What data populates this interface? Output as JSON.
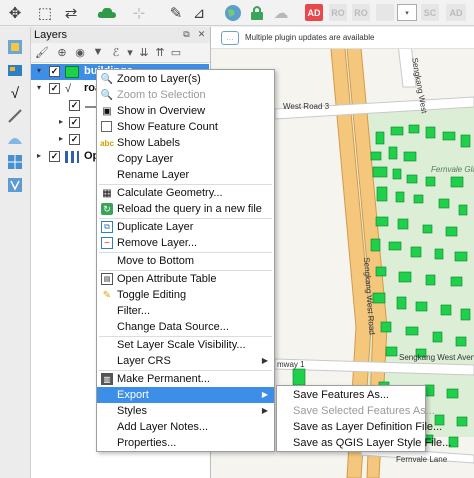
{
  "colors": {
    "selection": "#3d8ee6",
    "building_fill": "#1ed04a",
    "road_major": "#f5c77d",
    "road_minor": "#ffffff",
    "grass": "#d7eed2",
    "disabled_text": "#9a9a9a",
    "badge_red": "#e8474c"
  },
  "toolbar": {
    "icons": [
      "move-feature-icon",
      "pan-icon",
      "cloud-icon",
      "select-icon",
      "digitize-icon",
      "node-icon",
      "globe-icon",
      "lock-icon",
      "cloud-upload-icon"
    ],
    "badges": [
      "AD",
      "RO",
      "RO",
      "SC",
      "AD"
    ],
    "combo_value": ""
  },
  "panel": {
    "title": "Layers",
    "float_glyph": "⧉",
    "close_glyph": "✕"
  },
  "layers": [
    {
      "label": "buildings",
      "checked": true,
      "selected": true
    },
    {
      "label": "roa",
      "checked": true,
      "selected": false
    },
    {
      "label": "",
      "checked": true,
      "selected": false
    },
    {
      "label": "",
      "checked": true,
      "selected": false
    },
    {
      "label": "",
      "checked": true,
      "selected": false
    },
    {
      "label": "Op",
      "checked": true,
      "selected": false
    }
  ],
  "map": {
    "banner_text": "Multiple plugin updates are available",
    "road_labels": {
      "sengkang_road_3": "West Road 3",
      "sengkang_west_road": "Sengkang West Road",
      "sengkang_west_top": "Sengkang West",
      "sengkang_west_avenue": "Sengkang West Avenue",
      "fernvale_glades": "Fernvale Glades",
      "fernvale_lane": "Fernvale Lane",
      "sengkang_west_way": "mway 1"
    }
  },
  "context_menu": {
    "items": [
      {
        "label": "Zoom to Layer(s)",
        "icon": "zoom-layer-icon",
        "disabled": false
      },
      {
        "label": "Zoom to Selection",
        "icon": "zoom-selection-icon",
        "disabled": true
      },
      {
        "label": "Show in Overview",
        "icon": "overview-icon",
        "disabled": false
      },
      {
        "label": "Show Feature Count",
        "icon": "checkbox",
        "disabled": false
      },
      {
        "label": "Show Labels",
        "icon": "labels-icon",
        "disabled": false
      },
      {
        "label": "Copy Layer",
        "icon": "",
        "disabled": false
      },
      {
        "label": "Rename Layer",
        "icon": "",
        "disabled": false
      },
      {
        "label": "Calculate Geometry...",
        "icon": "calculator-icon",
        "disabled": false
      },
      {
        "label": "Reload the query in a new file",
        "icon": "reload-icon",
        "disabled": false
      },
      {
        "label": "Duplicate Layer",
        "icon": "duplicate-icon",
        "disabled": false
      },
      {
        "label": "Remove Layer...",
        "icon": "remove-icon",
        "disabled": false
      },
      {
        "label": "Move to Bottom",
        "icon": "",
        "disabled": false
      },
      {
        "label": "Open Attribute Table",
        "icon": "table-icon",
        "disabled": false
      },
      {
        "label": "Toggle Editing",
        "icon": "pencil-icon",
        "disabled": false
      },
      {
        "label": "Filter...",
        "icon": "",
        "disabled": false
      },
      {
        "label": "Change Data Source...",
        "icon": "",
        "disabled": false
      },
      {
        "label": "Set Layer Scale Visibility...",
        "icon": "",
        "disabled": false
      },
      {
        "label": "Layer CRS",
        "icon": "",
        "disabled": false,
        "submenu": true
      },
      {
        "label": "Make Permanent...",
        "icon": "permanent-icon",
        "disabled": false
      },
      {
        "label": "Export",
        "icon": "",
        "disabled": false,
        "submenu": true,
        "highlighted": true
      },
      {
        "label": "Styles",
        "icon": "",
        "disabled": false,
        "submenu": true
      },
      {
        "label": "Add Layer Notes...",
        "icon": "",
        "disabled": false
      },
      {
        "label": "Properties...",
        "icon": "",
        "disabled": false
      }
    ],
    "submenu_arrow": "▶"
  },
  "export_submenu": {
    "items": [
      {
        "label": "Save Features As...",
        "disabled": false
      },
      {
        "label": "Save Selected Features As...",
        "disabled": true
      },
      {
        "label": "Save as Layer Definition File...",
        "disabled": false
      },
      {
        "label": "Save as QGIS Layer Style File...",
        "disabled": false
      }
    ]
  }
}
